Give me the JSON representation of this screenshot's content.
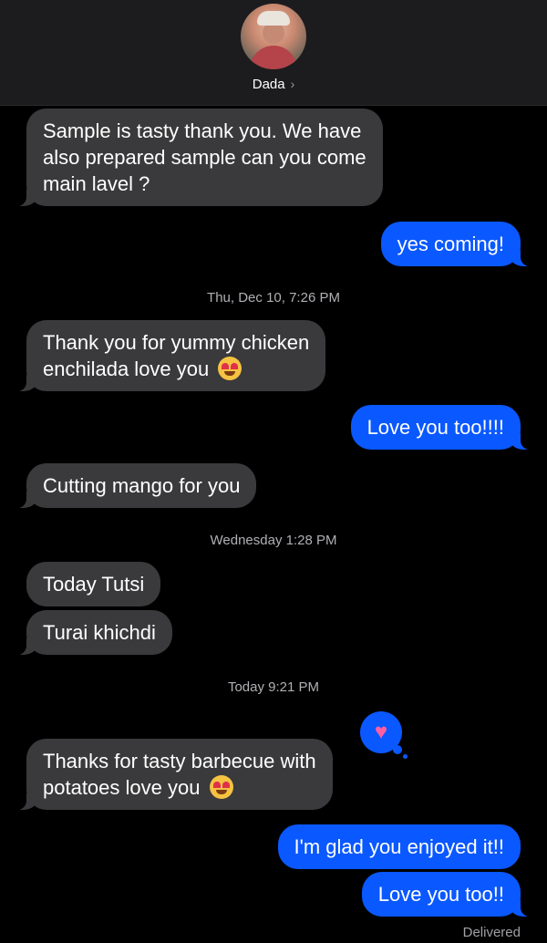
{
  "contact": {
    "name": "Dada",
    "chevron": "›",
    "avatar_icon": "contact-avatar"
  },
  "messages": [
    {
      "from": "them",
      "lines": [
        "Sample is tasty thank you.  We have",
        "also prepared sample can you come",
        "main lavel  ?"
      ]
    },
    {
      "from": "me",
      "text": "yes coming!"
    },
    {
      "type": "timestamp",
      "text": "Thu, Dec 10, 7:26 PM"
    },
    {
      "from": "them",
      "lines": [
        "Thank you for yummy chicken",
        "enchilada love you"
      ],
      "emoji": "😍"
    },
    {
      "from": "me",
      "text": "Love you too!!!!"
    },
    {
      "from": "them",
      "text": "Cutting mango for you"
    },
    {
      "type": "timestamp",
      "text": "Wednesday 1:28 PM"
    },
    {
      "from": "them",
      "text": "Today Tutsi"
    },
    {
      "from": "them",
      "text": "Turai khichdi"
    },
    {
      "type": "timestamp",
      "text": "Today 9:21 PM"
    },
    {
      "from": "them",
      "lines": [
        "Thanks for tasty barbecue with",
        "potatoes  love you"
      ],
      "emoji": "😍",
      "tapback": "heart"
    },
    {
      "from": "me",
      "text": "I'm glad you enjoyed it!!"
    },
    {
      "from": "me",
      "text": "Love you too!!"
    }
  ],
  "status": {
    "delivered": "Delivered"
  },
  "colors": {
    "incoming": "#3a3a3c",
    "outgoing": "#0a58ff",
    "background": "#000000",
    "heart": "#ff5fa2"
  }
}
